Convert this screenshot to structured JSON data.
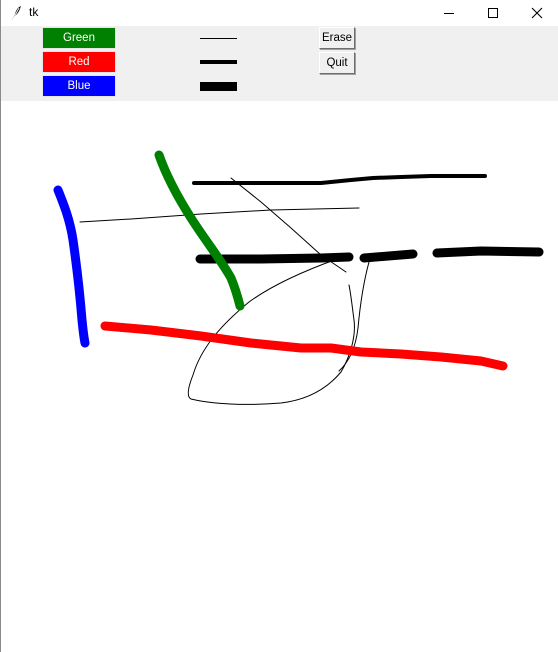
{
  "window": {
    "title": "tk",
    "icon": "feather-icon",
    "controls": [
      "minimize-icon",
      "maximize-icon",
      "close-icon"
    ]
  },
  "toolbar": {
    "color_buttons": [
      {
        "label": "Green",
        "color": "#008000"
      },
      {
        "label": "Red",
        "color": "#ff0000"
      },
      {
        "label": "Blue",
        "color": "#0000ff"
      }
    ],
    "pen_widths": [
      "thin",
      "medium",
      "thick"
    ],
    "erase_label": "Erase",
    "quit_label": "Quit"
  },
  "canvas": {
    "background": "#ffffff",
    "strokes": [
      {
        "name": "green-stroke",
        "color": "#008000",
        "width": "thick"
      },
      {
        "name": "blue-stroke",
        "color": "#0000ff",
        "width": "thick"
      },
      {
        "name": "red-stroke",
        "color": "#ff0000",
        "width": "thick"
      },
      {
        "name": "black-medium-stroke",
        "color": "#000000",
        "width": "medium"
      },
      {
        "name": "black-thick-stroke",
        "color": "#000000",
        "width": "thick"
      },
      {
        "name": "black-thin-strokes",
        "color": "#000000",
        "width": "thin"
      }
    ]
  }
}
